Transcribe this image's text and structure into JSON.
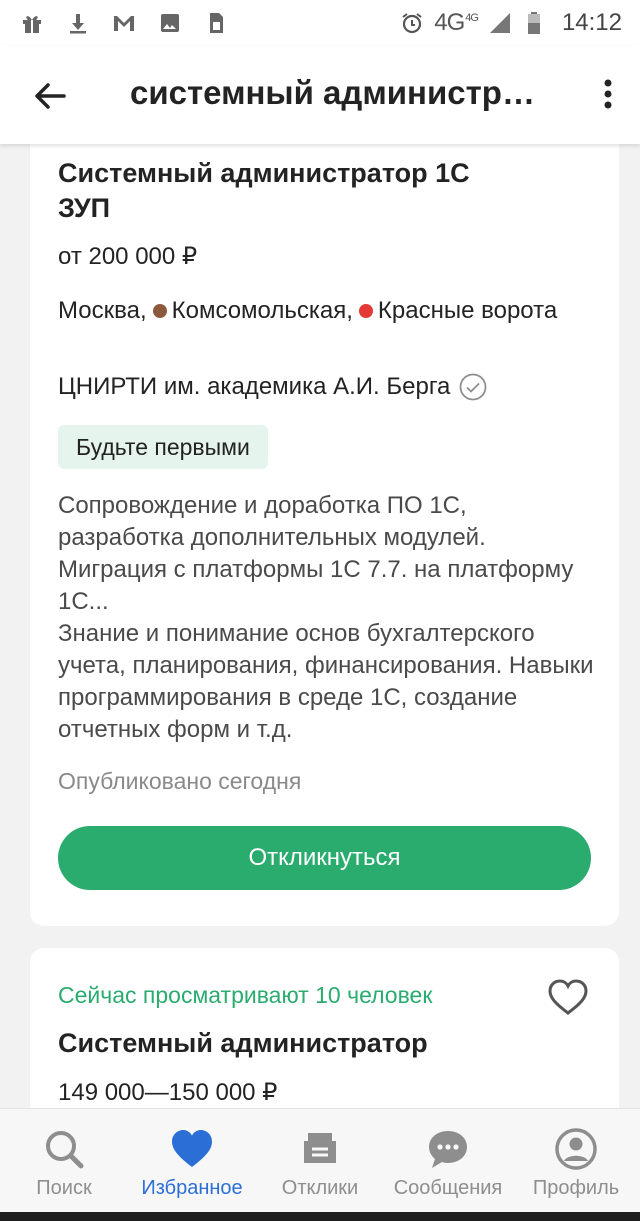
{
  "status_bar": {
    "time": "14:12",
    "network": "4G",
    "network_small": "4G",
    "icons": [
      "gift-icon",
      "download-icon",
      "gmail-icon",
      "image-icon",
      "sim-icon",
      "alarm-icon",
      "signal-icon",
      "battery-icon"
    ]
  },
  "appbar": {
    "title": "системный администр…",
    "back_icon": "arrow-left-icon",
    "more_icon": "more-vert-icon"
  },
  "vacancy1": {
    "title": "Системный администратор 1С ЗУП",
    "salary": "от 200 000 ₽",
    "city": "Москва,",
    "metro": [
      {
        "name": "Комсомольская,",
        "color": "#8b5a3c"
      },
      {
        "name": "Красные ворота",
        "color": "#e53935"
      }
    ],
    "company": "ЦНИРТИ им. академика А.И. Берга",
    "badge": "Будьте первыми",
    "description": "Сопровождение и доработка ПО 1С, разработка дополнительных модулей. Миграция с платформы 1С 7.7. на платформу 1С...\nЗнание и понимание основ бухгалтерского учета, планирования, финансирования. Навыки программирования в среде 1С, создание отчетных форм и т.д.",
    "published": "Опубликовано сегодня",
    "respond_label": "Откликнуться"
  },
  "vacancy2": {
    "viewers": "Сейчас просматривают 10 человек",
    "title": "Системный администратор",
    "salary": "149 000—150 000 ₽"
  },
  "bottom_nav": {
    "items": [
      {
        "label": "Поиск",
        "icon": "search-icon",
        "active": false
      },
      {
        "label": "Избранное",
        "icon": "heart-icon",
        "active": true
      },
      {
        "label": "Отклики",
        "icon": "responses-icon",
        "active": false
      },
      {
        "label": "Сообщения",
        "icon": "chat-icon",
        "active": false
      },
      {
        "label": "Профиль",
        "icon": "profile-icon",
        "active": false
      }
    ]
  },
  "colors": {
    "accent": "#2aac6f",
    "active_nav": "#2b6fd6",
    "badge_bg": "#e6f4ee"
  }
}
